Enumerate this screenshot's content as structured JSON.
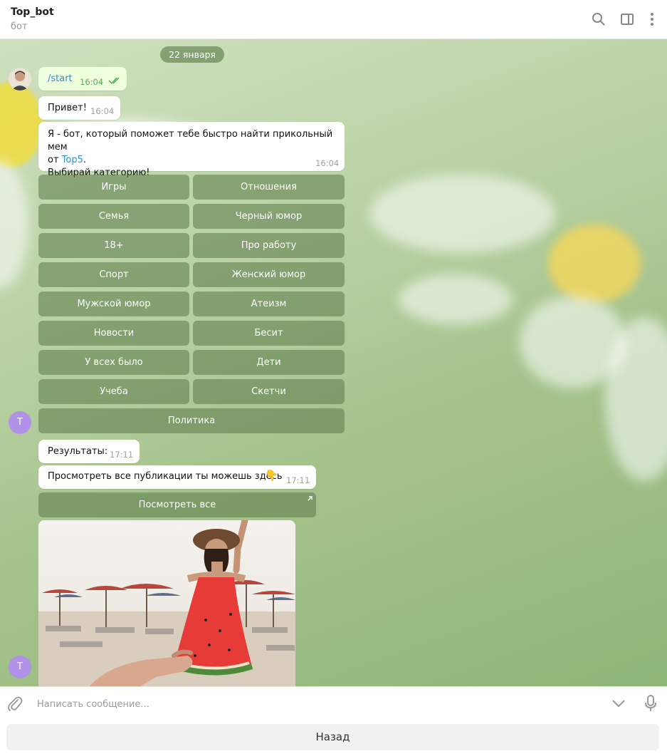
{
  "header": {
    "title": "Top_bot",
    "subtitle": "бот",
    "icons": [
      "search-icon",
      "sidebar-toggle-icon",
      "more-vertical-icon"
    ]
  },
  "chat": {
    "date": "22 января",
    "messages": {
      "start": {
        "text": "/start",
        "time": "16:04"
      },
      "hello": {
        "text": "Привет!",
        "time": "16:04"
      },
      "intro": {
        "line1": "Я - бот, который поможет тебе быстро найти прикольный мем",
        "line2_prefix": "от ",
        "line2_link": "Top5",
        "line2_suffix": ".",
        "line3": "Выбирай категорию!",
        "time": "16:04"
      },
      "results": {
        "text": "Результаты:",
        "time": "17:11"
      },
      "view_all": {
        "text": "Просмотреть все публикации ты можешь здесь",
        "emoji": "👇",
        "time": "17:11"
      }
    },
    "keyboard": [
      "Игры",
      "Отношения",
      "Семья",
      "Черный юмор",
      "18+",
      "Про работу",
      "Спорт",
      "Женский юмор",
      "Мужской юмор",
      "Атеизм",
      "Новости",
      "Бесит",
      "У всех было",
      "Дети",
      "Учеба",
      "Скетчи",
      "Политика"
    ],
    "inline_button": "Посмотреть все",
    "avatar_letter": "T"
  },
  "composer": {
    "placeholder": "Написать сообщение...",
    "icons": [
      "paperclip-icon",
      "chevron-down-icon",
      "microphone-icon"
    ]
  },
  "bottom": {
    "back_label": "Назад"
  }
}
